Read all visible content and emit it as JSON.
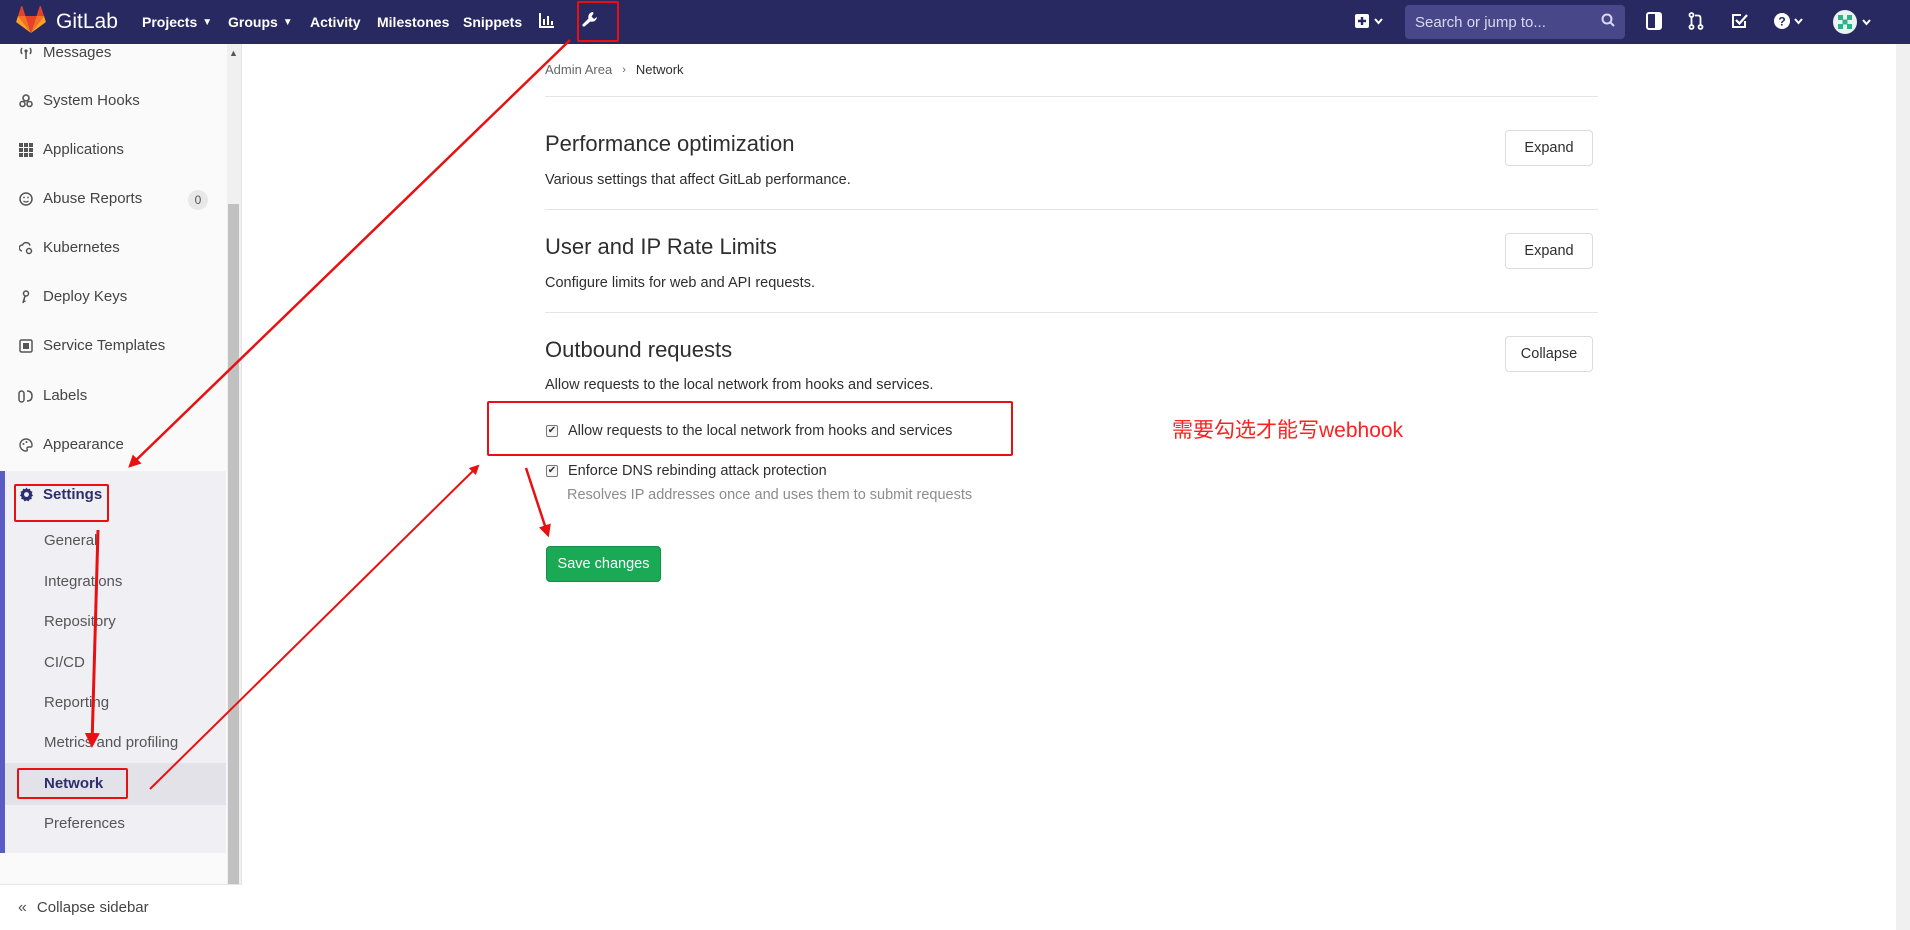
{
  "navbar": {
    "brand": "GitLab",
    "items": [
      "Projects",
      "Groups",
      "Activity",
      "Milestones",
      "Snippets"
    ],
    "search_placeholder": "Search or jump to...",
    "icons": [
      "chart-icon",
      "wrench-icon",
      "plus-square-icon",
      "todo-sidebar-icon",
      "merge-request-icon",
      "check-square-icon",
      "help-icon",
      "avatar"
    ]
  },
  "sidebar": {
    "items": [
      {
        "label": "Messages",
        "icon": "broadcast-icon"
      },
      {
        "label": "System Hooks",
        "icon": "hook-icon"
      },
      {
        "label": "Applications",
        "icon": "grid-icon"
      },
      {
        "label": "Abuse Reports",
        "icon": "smiley-icon",
        "badge": "0"
      },
      {
        "label": "Kubernetes",
        "icon": "cloud-gear-icon"
      },
      {
        "label": "Deploy Keys",
        "icon": "key-icon"
      },
      {
        "label": "Service Templates",
        "icon": "template-icon"
      },
      {
        "label": "Labels",
        "icon": "labels-icon"
      },
      {
        "label": "Appearance",
        "icon": "palette-icon"
      }
    ],
    "settings": {
      "label": "Settings",
      "subitems": [
        "General",
        "Integrations",
        "Repository",
        "CI/CD",
        "Reporting",
        "Metrics and profiling",
        "Network",
        "Preferences"
      ]
    },
    "collapse_label": "Collapse sidebar"
  },
  "breadcrumb": {
    "parent": "Admin Area",
    "current": "Network"
  },
  "sections": [
    {
      "title": "Performance optimization",
      "desc": "Various settings that affect GitLab performance.",
      "button": "Expand"
    },
    {
      "title": "User and IP Rate Limits",
      "desc": "Configure limits for web and API requests.",
      "button": "Expand"
    },
    {
      "title": "Outbound requests",
      "desc": "Allow requests to the local network from hooks and services.",
      "button": "Collapse"
    }
  ],
  "outbound": {
    "allow_local_label": "Allow requests to the local network from hooks and services",
    "allow_local_checked": true,
    "dns_label": "Enforce DNS rebinding attack protection",
    "dns_checked": true,
    "dns_help": "Resolves IP addresses once and uses them to submit requests",
    "save_label": "Save changes"
  },
  "annotation": {
    "note": "需要勾选才能写webhook",
    "color": "#e81010"
  },
  "colors": {
    "navbar": "#292961",
    "accent": "#5b5bc4",
    "save": "#1aaa55"
  }
}
